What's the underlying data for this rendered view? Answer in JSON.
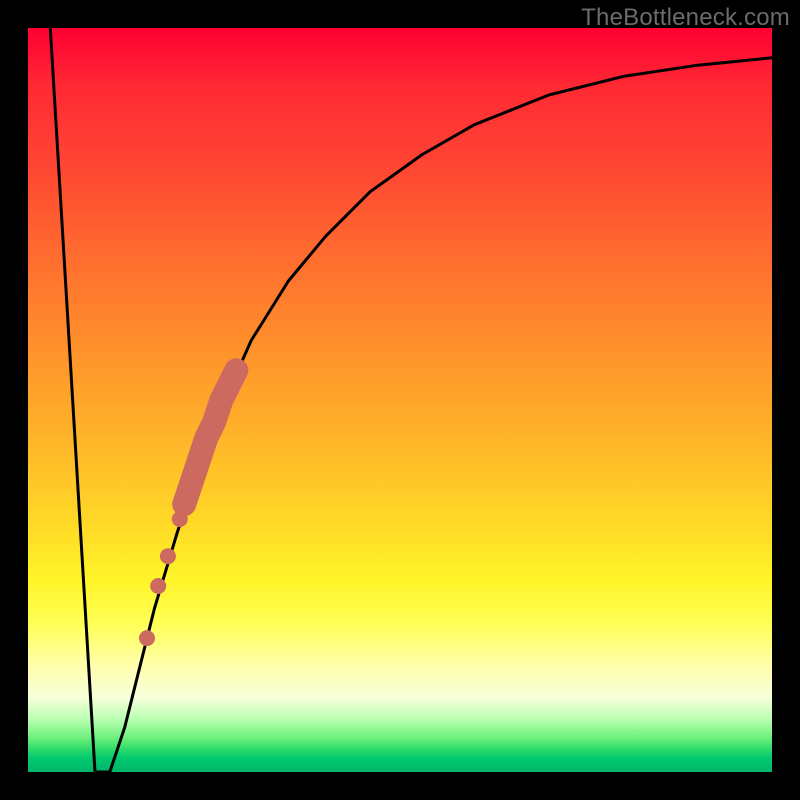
{
  "watermark": "TheBottleneck.com",
  "colors": {
    "curve": "#000000",
    "marker": "#cd6a5f",
    "background_frame": "#000000"
  },
  "chart_data": {
    "type": "line",
    "title": "",
    "xlabel": "",
    "ylabel": "",
    "xlim": [
      0,
      100
    ],
    "ylim": [
      0,
      100
    ],
    "series": [
      {
        "name": "v-curve",
        "description": "Steep V notch near left edge followed by saturating rise",
        "x": [
          3,
          9,
          11,
          13,
          15,
          17,
          20,
          23,
          26,
          30,
          35,
          40,
          46,
          53,
          60,
          70,
          80,
          90,
          100
        ],
        "y": [
          100,
          0,
          0,
          6,
          14,
          22,
          32,
          41,
          49,
          58,
          66,
          72,
          78,
          83,
          87,
          91,
          93.5,
          95,
          96
        ]
      }
    ],
    "scatter_markers": {
      "name": "highlighted-points",
      "color": "#cd6a5f",
      "description": "Salmon dots along the rising branch, clustered in a band",
      "points": [
        {
          "x": 16.0,
          "y": 18,
          "r": 8
        },
        {
          "x": 17.5,
          "y": 25,
          "r": 8
        },
        {
          "x": 18.8,
          "y": 29,
          "r": 8
        },
        {
          "x": 20.4,
          "y": 34,
          "r": 8
        },
        {
          "x": 21.0,
          "y": 36,
          "r": 11,
          "band": true
        },
        {
          "x": 22.0,
          "y": 39,
          "r": 11,
          "band": true
        },
        {
          "x": 23.0,
          "y": 42,
          "r": 11,
          "band": true
        },
        {
          "x": 24.0,
          "y": 45,
          "r": 11,
          "band": true
        },
        {
          "x": 25.0,
          "y": 47,
          "r": 11,
          "band": true
        },
        {
          "x": 26.0,
          "y": 50,
          "r": 11,
          "band": true
        },
        {
          "x": 27.0,
          "y": 52,
          "r": 11,
          "band": true
        },
        {
          "x": 28.0,
          "y": 54,
          "r": 11,
          "band": true
        }
      ]
    }
  }
}
